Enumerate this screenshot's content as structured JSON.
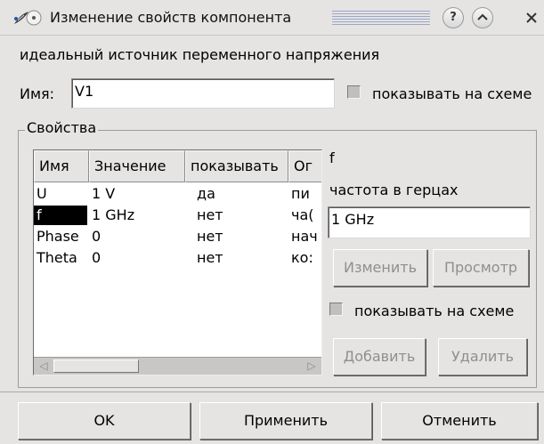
{
  "window": {
    "title": "Изменение свойств компонента",
    "help_icon": "question-mark-icon",
    "shade_icon": "chevron-up-icon",
    "close_icon": "close-icon",
    "app_icon": "feather-icon",
    "menu_icon": "circle-dot-icon"
  },
  "component": {
    "description": "идеальный источник переменного напряжения",
    "name_label": "Имя:",
    "name_value": "V1",
    "show_on_schematic_label": "показывать на схеме"
  },
  "properties": {
    "group_title": "Свойства",
    "columns": [
      "Имя",
      "Значение",
      "показывать",
      "Ог"
    ],
    "rows": [
      {
        "name": "U",
        "value": "1 V",
        "show": "да",
        "desc": "пи"
      },
      {
        "name": "f",
        "value": "1 GHz",
        "show": "нет",
        "desc": "ча("
      },
      {
        "name": "Phase",
        "value": "0",
        "show": "нет",
        "desc": "нач"
      },
      {
        "name": "Theta",
        "value": "0",
        "show": "нет",
        "desc": "ко:"
      }
    ],
    "selected_row": 1
  },
  "editor": {
    "param_name": "f",
    "param_description": "частота в герцах",
    "value": "1 GHz",
    "change_button": "Изменить",
    "browse_button": "Просмотр",
    "show_on_schematic_label": "показывать на схеме",
    "add_button": "Добавить",
    "delete_button": "Удалить"
  },
  "footer": {
    "ok": "OK",
    "apply": "Применить",
    "cancel": "Отменить"
  }
}
